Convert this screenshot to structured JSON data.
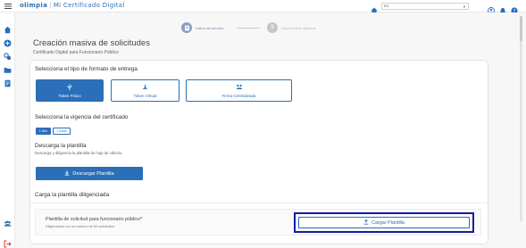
{
  "header": {
    "brand": "olimpia",
    "app_title": "Mi Certificado Digital",
    "language_value": "ES",
    "icons": [
      "menu-icon",
      "home-icon",
      "user-icon",
      "bell-icon",
      "help-icon"
    ]
  },
  "sidebar": {
    "items": [
      {
        "icon": "home-icon"
      },
      {
        "icon": "add-circle-icon"
      },
      {
        "icon": "network-icon"
      },
      {
        "icon": "folder-icon"
      },
      {
        "icon": "document-icon"
      }
    ],
    "bottom_items": [
      {
        "icon": "users-icon"
      },
      {
        "icon": "logout-icon"
      }
    ]
  },
  "stepper": {
    "steps": [
      {
        "label": "Datos del servicio",
        "active": true
      },
      {
        "label": "Documentos adjuntos",
        "active": false
      }
    ]
  },
  "page": {
    "title": "Creación masiva de solicitudes",
    "subtitle": "Certificado Digital para Funcionario Público"
  },
  "format_section": {
    "title": "Selecciona el tipo de formato de entrega",
    "options": [
      {
        "label": "Token Físico",
        "icon": "usb-icon",
        "selected": true
      },
      {
        "label": "Token Virtual",
        "icon": "cloud-icon",
        "selected": false
      },
      {
        "label": "Firma Centralizada",
        "icon": "users-icon",
        "selected": false
      }
    ]
  },
  "validity_section": {
    "title": "Selecciona la vigencia del certificado",
    "options": [
      {
        "label": "1 Año",
        "selected": true
      },
      {
        "label": "2 Años",
        "selected": false
      }
    ]
  },
  "download_section": {
    "title": "Descarga la plantilla",
    "description": "Descarga y diligencia la plantilla de hoja de cálculo.",
    "button_label": "Descargar Plantilla"
  },
  "upload_section": {
    "title": "Carga la plantilla diligenciada",
    "field_label": "Plantilla de solicitud para funcionario público*",
    "field_description": "Diligenciada con un máximo de 50 solicitudes.",
    "button_label": "Cargar Plantilla"
  },
  "colors": {
    "primary": "#2a6fb8",
    "highlight": "#1a1aa6",
    "step_active": "#8c9fc0",
    "step_inactive": "#c6c6c6"
  }
}
